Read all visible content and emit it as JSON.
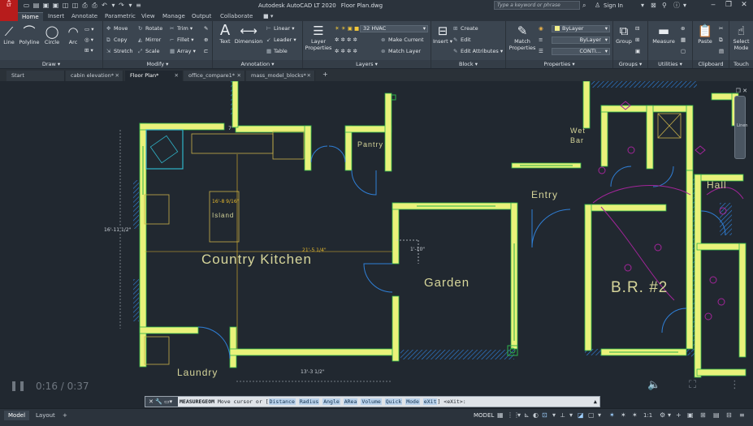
{
  "app": {
    "logo": "A",
    "logo_sub": "LT",
    "title": "Autodesk AutoCAD LT 2020",
    "file": "Floor Plan.dwg",
    "search_placeholder": "Type a keyword or phrase",
    "sign_in": "Sign In"
  },
  "ribbon_tabs": [
    {
      "label": "Home",
      "active": true
    },
    {
      "label": "Insert"
    },
    {
      "label": "Annotate"
    },
    {
      "label": "Parametric"
    },
    {
      "label": "View"
    },
    {
      "label": "Manage"
    },
    {
      "label": "Output"
    },
    {
      "label": "Collaborate"
    }
  ],
  "panels": {
    "draw": {
      "title": "Draw",
      "tools": [
        "Line",
        "Polyline",
        "Circle",
        "Arc"
      ]
    },
    "modify": {
      "title": "Modify",
      "tools": [
        "Move",
        "Rotate",
        "Trim",
        "Copy",
        "Mirror",
        "Fillet",
        "Stretch",
        "Scale",
        "Array"
      ]
    },
    "annotation": {
      "title": "Annotation",
      "text": "Text",
      "dimension": "Dimension",
      "tools": [
        "Linear",
        "Leader",
        "Table"
      ]
    },
    "layers": {
      "title": "Layers",
      "layer_properties": "Layer Properties",
      "current_layer": "32 HVAC",
      "tools": [
        "Make Current",
        "Match Layer"
      ]
    },
    "block": {
      "title": "Block",
      "insert": "Insert",
      "tools": [
        "Create",
        "Edit",
        "Edit Attributes"
      ]
    },
    "properties": {
      "title": "Properties",
      "match": "Match Properties",
      "color": "ByLayer",
      "lineweight": "ByLayer",
      "linetype": "CONTI..."
    },
    "groups": {
      "title": "Groups",
      "label": "Group"
    },
    "utilities": {
      "title": "Utilities",
      "label": "Measure"
    },
    "clipboard": {
      "title": "Clipboard",
      "label": "Paste"
    },
    "touch": {
      "title": "Touch",
      "label": "Select Mode"
    }
  },
  "doc_tabs": [
    {
      "label": "Start"
    },
    {
      "label": "cabin elevation*"
    },
    {
      "label": "Floor Plan*",
      "active": true
    },
    {
      "label": "office_compare1*"
    },
    {
      "label": "mass_model_blocks*"
    }
  ],
  "drawing": {
    "rooms": [
      "Country Kitchen",
      "Garden",
      "B.R. #2",
      "Laundry",
      "Pantry",
      "Entry",
      "Hall",
      "Island",
      "Wet",
      "Bar",
      "Linen"
    ],
    "dimensions": [
      "16'-8 9/16\"",
      "21'-5 1/4\"",
      "16'-11 1/2\"",
      "1'-10\"",
      "13'-3 1/2\"",
      "7'"
    ]
  },
  "video": {
    "time": "0:16 / 0:37"
  },
  "command": {
    "name": "MEASUREGEOM",
    "prompt": "Move cursor or [",
    "options": [
      "Distance",
      "Radius",
      "Angle",
      "ARea",
      "Volume",
      "Quick",
      "Mode",
      "eXit"
    ],
    "suffix": "] <eXit>:"
  },
  "status": {
    "tabs": [
      {
        "label": "Model",
        "active": true
      },
      {
        "label": "Layout"
      }
    ],
    "space": "MODEL",
    "scale": "1:1"
  },
  "colors": {
    "wall_fill": "#e9f27a",
    "wall_edge": "#2fb34b",
    "hatch": "#2f7fd6",
    "door": "#2f7fd6",
    "electrical": "#a3259a",
    "room_text": "#d6d59a"
  }
}
